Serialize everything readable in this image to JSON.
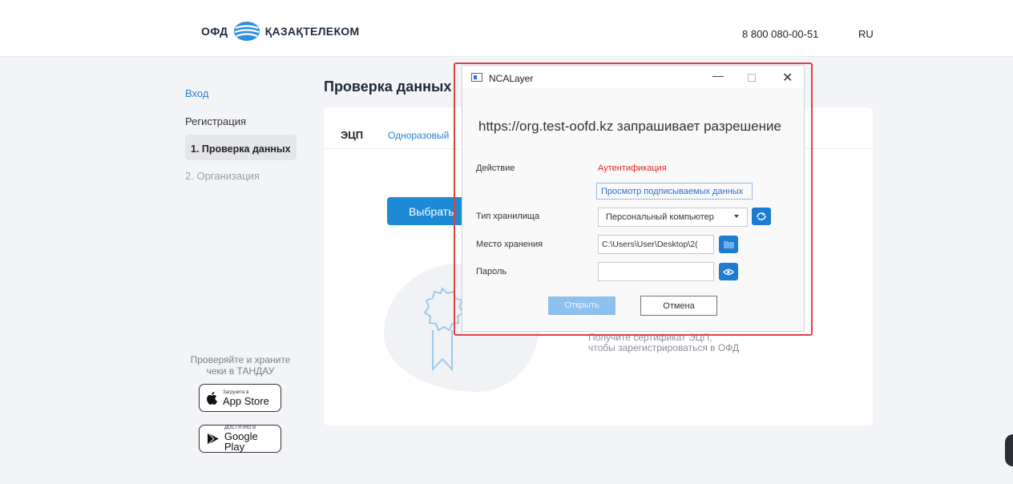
{
  "header": {
    "logo_ofd": "ОФД",
    "logo_brand": "ҚАЗАҚТЕЛЕКОМ",
    "phone": "8 800 080-00-51",
    "lang": "RU"
  },
  "sidebar": {
    "items": [
      {
        "label": "Вход"
      },
      {
        "label": "Регистрация"
      },
      {
        "label": "1. Проверка данных"
      },
      {
        "label": "2. Организация"
      }
    ],
    "promo_text": "Проверяйте и храните чеки в ТАНДАУ",
    "app_store": {
      "small": "Загрузите в",
      "big": "App Store"
    },
    "google_play": {
      "small": "ДОСТУПНО В",
      "big": "Google Play"
    }
  },
  "main": {
    "title": "Проверка данных",
    "tabs": [
      {
        "label": "ЭЦП"
      },
      {
        "label": "Одноразовый"
      }
    ],
    "choose_button": "Выбрать",
    "hint_line1": "Получите сертификат ЭЦП,",
    "hint_line2": "чтобы зарегистрироваться в ОФД"
  },
  "dialog": {
    "title": "NCALayer",
    "request": "https://org.test-oofd.kz запрашивает разрешение",
    "action_label": "Действие",
    "action_value": "Аутентификация",
    "view_link": "Просмотр подписываемых данных",
    "storage_type_label": "Тип хранилища",
    "storage_type_value": "Персональный компьютер",
    "storage_place_label": "Место хранения",
    "storage_place_value": "C:\\Users\\User\\Desktop\\2(",
    "password_label": "Пароль",
    "password_value": "",
    "open_button": "Открыть",
    "cancel_button": "Отмена"
  },
  "colors": {
    "accent": "#1d8ad6",
    "highlight_frame": "#e04040",
    "auth_red": "#e02828"
  },
  "icons": [
    "ofd-logo-icon",
    "app-icon",
    "minimize-icon",
    "maximize-icon",
    "close-icon",
    "refresh-icon",
    "folder-icon",
    "eye-icon",
    "apple-icon",
    "google-play-icon",
    "certificate-icon"
  ]
}
